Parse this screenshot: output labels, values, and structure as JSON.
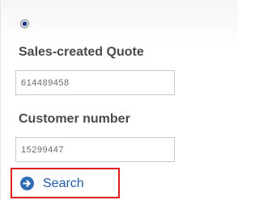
{
  "form": {
    "radio_selected": true,
    "quote_label": "Sales-created Quote",
    "quote_value": "614489458",
    "customer_label": "Customer number",
    "customer_value": "15299447",
    "search_label": "Search",
    "search_icon": "arrow-right-circle-icon"
  },
  "colors": {
    "highlight_border": "#e11c1c",
    "link_blue": "#1f5aa8",
    "icon_blue": "#2e6db3"
  }
}
